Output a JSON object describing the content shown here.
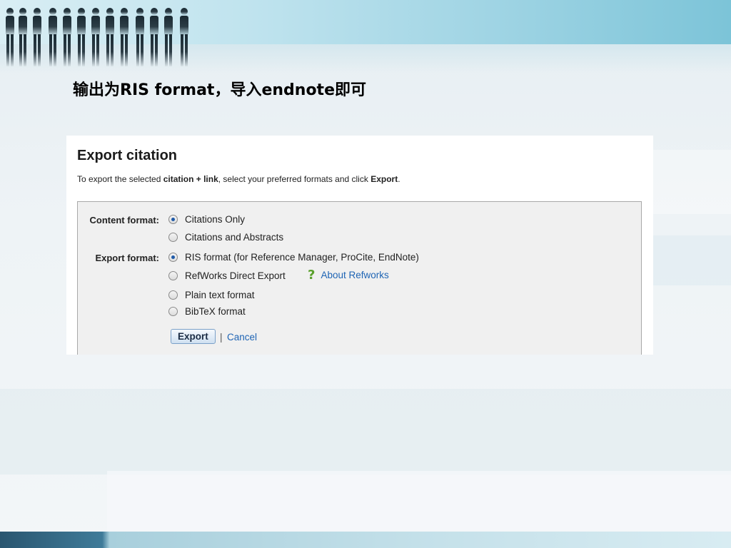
{
  "slide": {
    "title": "输出为RIS format，导入endnote即可"
  },
  "dialog": {
    "heading": "Export citation",
    "description": {
      "prefix": "To export the selected ",
      "bold1": "citation + link",
      "middle": ", select your preferred formats and click ",
      "bold2": "Export",
      "suffix": "."
    },
    "content_format": {
      "label": "Content format:",
      "options": [
        {
          "label": "Citations Only",
          "checked": true
        },
        {
          "label": "Citations and Abstracts",
          "checked": false
        }
      ]
    },
    "export_format": {
      "label": "Export format:",
      "options": [
        {
          "label": "RIS format (for Reference Manager, ProCite, EndNote)",
          "checked": true
        },
        {
          "label": "RefWorks Direct Export",
          "checked": false
        },
        {
          "label": "Plain text format",
          "checked": false
        },
        {
          "label": "BibTeX format",
          "checked": false
        }
      ],
      "help_icon": "question-mark-icon",
      "help_link": "About Refworks"
    },
    "actions": {
      "export_label": "Export",
      "separator": "|",
      "cancel_label": "Cancel"
    }
  },
  "colors": {
    "link": "#1e64b4",
    "radio_selected": "#1f5aa8",
    "help_icon": "#5aa02c"
  }
}
